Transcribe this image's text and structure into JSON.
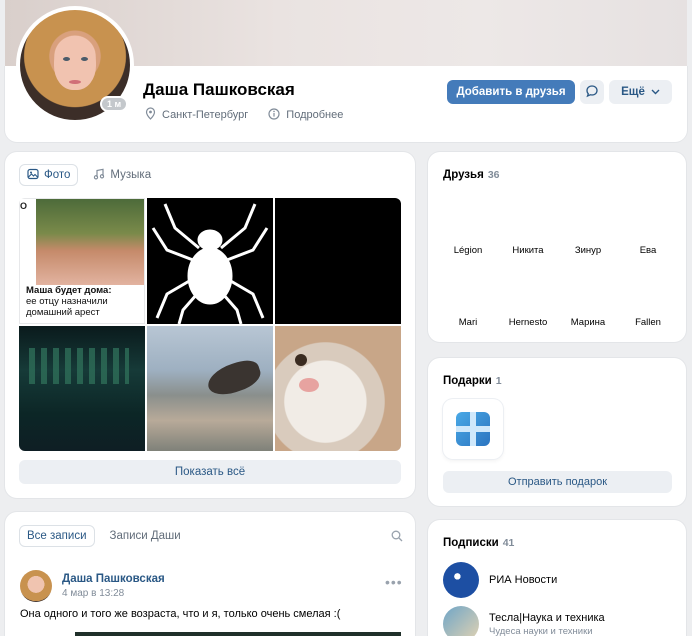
{
  "profile": {
    "name": "Даша Пашковская",
    "online_badge": "1 м",
    "city": "Санкт-Петербург",
    "more_info": "Подробнее",
    "add_friend_label": "Добавить в друзья",
    "more_label": "Ещё"
  },
  "photos": {
    "tabs": [
      {
        "label": "Фото",
        "icon": "photo-icon"
      },
      {
        "label": "Музыка",
        "icon": "music-note-icon"
      }
    ],
    "news_logo": "О",
    "news_caption_bold": "Маша будет дома:",
    "news_caption": "ее отцу назначили домашний арест",
    "show_all_label": "Показать всё"
  },
  "friends": {
    "title": "Друзья",
    "count": "36",
    "items": [
      "Légion",
      "Никита",
      "Зинур",
      "Ева",
      "Mari",
      "Hernesto",
      "Марина",
      "Fallen"
    ]
  },
  "gifts": {
    "title": "Подарки",
    "count": "1",
    "send_label": "Отправить подарок"
  },
  "posts": {
    "tabs": [
      "Все записи",
      "Записи Даши"
    ],
    "author": "Даша Пашковская",
    "date": "4 мар в 13:28",
    "text": "Она одного и того же возраста, что и я, только очень смелая :("
  },
  "subscriptions": {
    "title": "Подписки",
    "count": "41",
    "items": [
      {
        "name": "РИА Новости",
        "desc": ""
      },
      {
        "name": "Тесла|Наука и техника",
        "desc": "Чудеса науки и техники"
      }
    ]
  },
  "colors": {
    "accent": "#447bba",
    "link": "#2a5885",
    "background": "#edeef0",
    "secondary_button": "#eceff3"
  }
}
